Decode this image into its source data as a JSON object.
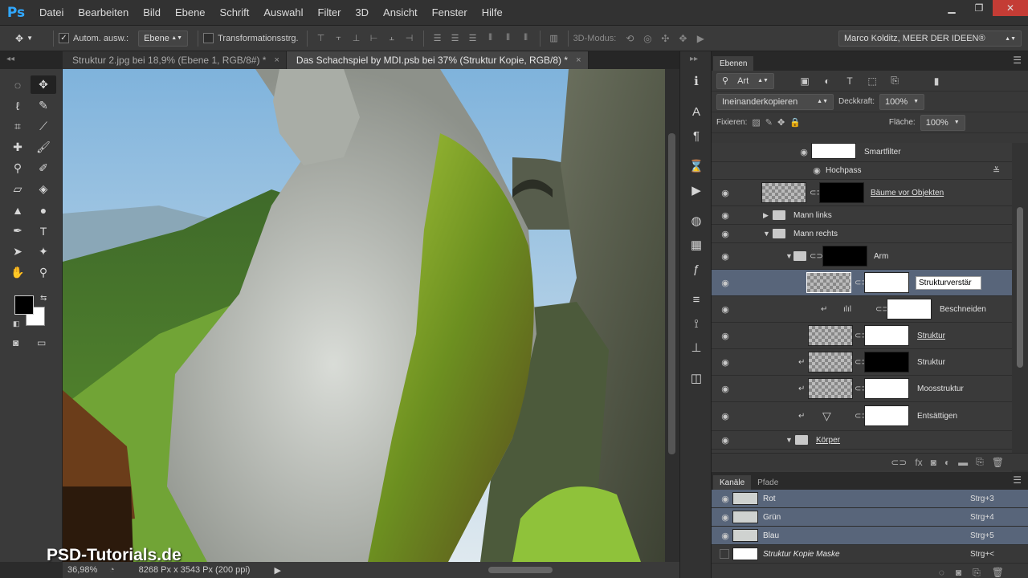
{
  "app": {
    "logo": "Ps"
  },
  "menu": [
    "Datei",
    "Bearbeiten",
    "Bild",
    "Ebene",
    "Schrift",
    "Auswahl",
    "Filter",
    "3D",
    "Ansicht",
    "Fenster",
    "Hilfe"
  ],
  "window_controls": {
    "minimize": "▁",
    "restore": "❐",
    "close": "✕"
  },
  "options": {
    "autoselect_label": "Autom. ausw.:",
    "autoselect_checked": "✓",
    "autoselect_value": "Ebene",
    "transform_label": "Transformationsstrg.",
    "mode_label": "3D-Modus:",
    "workspace": "Marco Kolditz, MEER DER IDEEN®"
  },
  "tabs": [
    {
      "label": "Struktur 2.jpg bei 18,9% (Ebene 1, RGB/8#) *",
      "close": "×"
    },
    {
      "label": "Das Schachspiel by MDI.psb bei 37% (Struktur Kopie, RGB/8) *",
      "close": "×"
    }
  ],
  "status": {
    "zoom": "36,98%",
    "doc_info": "8268 Px x 3543 Px (200 ppi)"
  },
  "watermark": "PSD-Tutorials.de",
  "layers_panel": {
    "tab": "Ebenen",
    "filter": "Art",
    "blend_mode": "Ineinanderkopieren",
    "opacity_label": "Deckkraft:",
    "opacity_value": "100%",
    "lock_label": "Fixieren:",
    "fill_label": "Fläche:",
    "fill_value": "100%",
    "rows": [
      {
        "name": "Smartfilter"
      },
      {
        "name": "Hochpass"
      },
      {
        "name": "Bäume vor Objekten"
      },
      {
        "name": "Mann links"
      },
      {
        "name": "Mann rechts"
      },
      {
        "name": "Arm"
      },
      {
        "name": "Strukturverstär"
      },
      {
        "name": "Beschneiden"
      },
      {
        "name": "Struktur"
      },
      {
        "name": "Struktur"
      },
      {
        "name": "Moosstruktur"
      },
      {
        "name": "Entsättigen"
      },
      {
        "name": "Körper"
      }
    ]
  },
  "channels_panel": {
    "tabs": [
      "Kanäle",
      "Pfade"
    ],
    "rows": [
      {
        "name": "Rot",
        "shortcut": "Strg+3"
      },
      {
        "name": "Grün",
        "shortcut": "Strg+4"
      },
      {
        "name": "Blau",
        "shortcut": "Strg+5"
      },
      {
        "name": "Struktur Kopie Maske",
        "shortcut": "Strg+<"
      }
    ]
  }
}
